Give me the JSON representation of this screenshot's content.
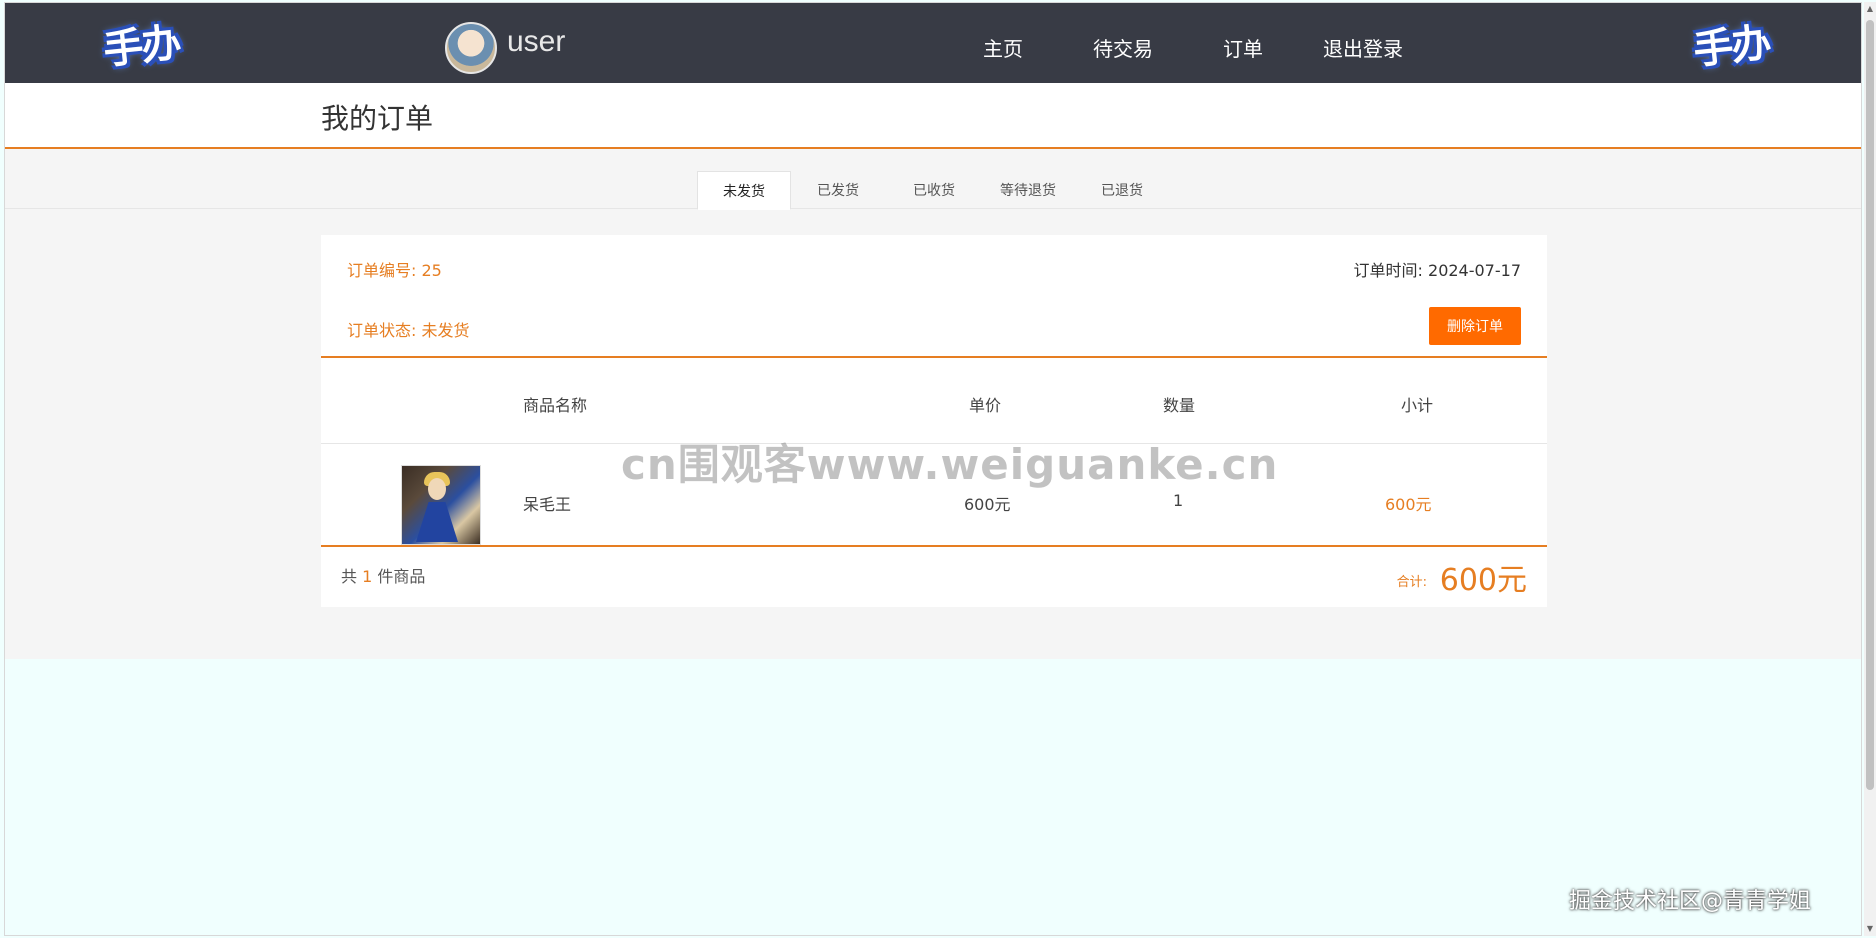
{
  "nav": {
    "logo_text": "手办",
    "username": "user",
    "items": [
      "主页",
      "待交易",
      "订单",
      "退出登录"
    ]
  },
  "page": {
    "title": "我的订单"
  },
  "tabs": [
    "未发货",
    "已发货",
    "已收货",
    "等待退货",
    "已退货"
  ],
  "active_tab": "未发货",
  "order": {
    "number_label": "订单编号: 25",
    "time_label": "订单时间: 2024-07-17",
    "status_label": "订单状态: 未发货",
    "delete_label": "删除订单",
    "table_headers": {
      "name": "商品名称",
      "price": "单价",
      "qty": "数量",
      "subtotal": "小计"
    },
    "items": [
      {
        "name": "呆毛王",
        "price": "600元",
        "qty": "1",
        "subtotal": "600元"
      }
    ],
    "count_prefix": "共",
    "count_value": "1",
    "count_suffix": "件商品",
    "total_label": "合计:",
    "total_value": "600元"
  },
  "overlay": {
    "watermark": "cn围观客www.weiguanke.cn",
    "credit": "掘金技术社区@青青学姐"
  },
  "colors": {
    "accent": "#e67e22",
    "button": "#ff6a00",
    "topbar": "#383b45"
  }
}
